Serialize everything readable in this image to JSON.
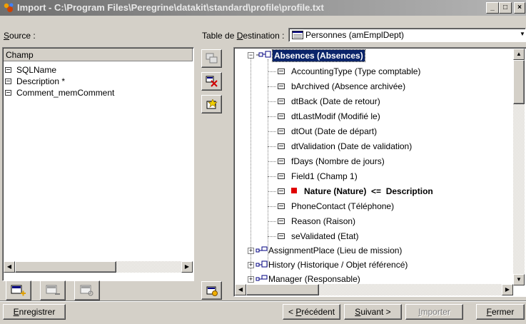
{
  "window": {
    "title": "Import - C:\\Program Files\\Peregrine\\datakit\\standard\\profile\\profile.txt"
  },
  "title_buttons": {
    "minimize": "_",
    "maximize": "□",
    "close": "×"
  },
  "source": {
    "label_prefix": "S",
    "label_rest": "ource :",
    "header": "Champ",
    "items": [
      "SQLName",
      "Description *",
      "Comment_memComment"
    ]
  },
  "destination": {
    "label_before": "Table de ",
    "label_u": "D",
    "label_after": "estination :",
    "selected": "Personnes (amEmplDept)"
  },
  "tree": {
    "root": "Absences (Absences)",
    "fields": [
      "AccountingType (Type comptable)",
      "bArchived (Absence archivée)",
      "dtBack (Date de retour)",
      "dtLastModif (Modifié le)",
      "dtOut (Date de départ)",
      "dtValidation (Date de validation)",
      "fDays (Nombre de jours)",
      "Field1 (Champ 1)"
    ],
    "mapped": {
      "field": "Nature (Nature)",
      "arrow": "<=",
      "source": "Description",
      "marker_color": "#e00000"
    },
    "fields_after": [
      "PhoneContact (Téléphone)",
      "Reason (Raison)",
      "seValidated (Etat)"
    ],
    "links": [
      "AssignmentPlace (Lieu de mission)",
      "History (Historique / Objet référencé)",
      "Manager (Responsable)"
    ]
  },
  "buttons": {
    "save_u": "E",
    "save_rest": "nregistrer",
    "prev_pre": "< ",
    "prev_u": "P",
    "prev_rest": "récédent",
    "next_u": "S",
    "next_rest": "uivant >",
    "import_u": "I",
    "import_rest": "mporter",
    "close_u": "F",
    "close_rest": "ermer"
  },
  "colors": {
    "selection": "#0a246a",
    "title_bar": "#808080",
    "disabled_text": "#808080"
  }
}
